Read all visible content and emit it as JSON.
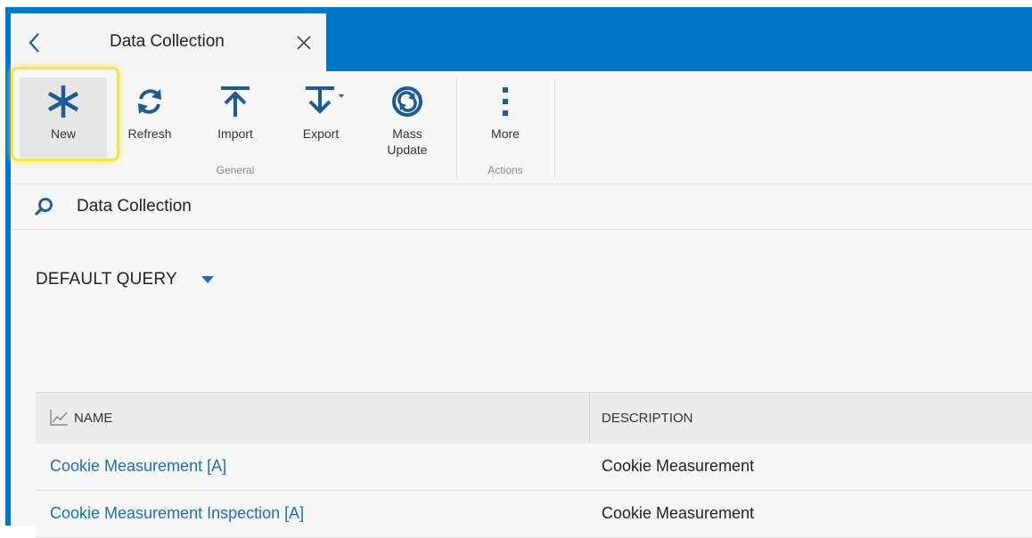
{
  "tab": {
    "title": "Data Collection"
  },
  "ribbon": {
    "buttons": {
      "new": "New",
      "refresh": "Refresh",
      "import": "Import",
      "export": "Export",
      "mass_update_line1": "Mass",
      "mass_update_line2": "Update",
      "more": "More"
    },
    "groups": {
      "general": "General",
      "actions": "Actions"
    }
  },
  "search": {
    "text": "Data Collection"
  },
  "query": {
    "selected": "DEFAULT QUERY"
  },
  "grid": {
    "columns": {
      "name": "NAME",
      "description": "DESCRIPTION"
    },
    "rows": [
      {
        "name": "Cookie Measurement [A]",
        "description": "Cookie Measurement"
      },
      {
        "name": "Cookie Measurement Inspection [A]",
        "description": "Cookie Measurement"
      }
    ]
  },
  "colors": {
    "brand_blue": "#0078c8",
    "icon_blue": "#1e5b94",
    "link_blue": "#1e6fb0",
    "highlight_yellow": "#f7e34a"
  }
}
